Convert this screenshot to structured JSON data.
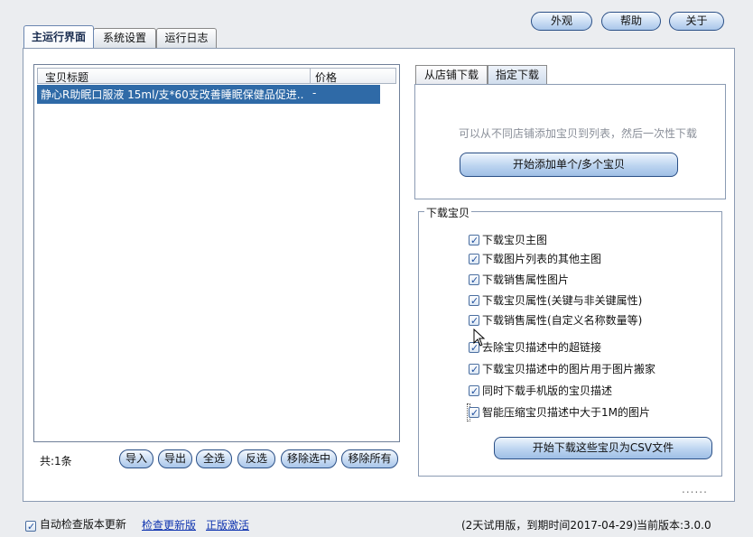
{
  "header_buttons": {
    "appearance": "外观",
    "help": "帮助",
    "about": "关于"
  },
  "tabs": {
    "main": "主运行界面",
    "settings": "系统设置",
    "log": "运行日志"
  },
  "list": {
    "col_title": "宝贝标题",
    "col_price": "价格",
    "rows": [
      {
        "title": "静心R助眠口服液 15ml/支*60支改善睡眠保健品促进...",
        "price": "-"
      }
    ]
  },
  "list_footer": {
    "count_text": "共:1条",
    "import": "导入",
    "export": "导出",
    "select_all": "全选",
    "invert": "反选",
    "remove_selected": "移除选中",
    "remove_all": "移除所有"
  },
  "sub_tabs": {
    "from_shop": "从店铺下载",
    "specified": "指定下载"
  },
  "sub_panel": {
    "hint": "可以从不同店铺添加宝贝到列表，然后一次性下载",
    "add_button": "开始添加单个/多个宝贝"
  },
  "download_group": {
    "title": "下载宝贝",
    "options": [
      {
        "label": "下载宝贝主图",
        "checked": true
      },
      {
        "label": "下载图片列表的其他主图",
        "checked": true
      },
      {
        "label": "下载销售属性图片",
        "checked": true
      },
      {
        "label": "下载宝贝属性(关键与非关键属性)",
        "checked": true
      },
      {
        "label": "下载销售属性(自定义名称数量等)",
        "checked": true
      },
      {
        "label": "去除宝贝描述中的超链接",
        "checked": true
      },
      {
        "label": "下载宝贝描述中的图片用于图片搬家",
        "checked": true
      },
      {
        "label": "同时下载手机版的宝贝描述",
        "checked": true
      },
      {
        "label": "智能压缩宝贝描述中大于1M的图片",
        "checked": true
      }
    ],
    "start_button": "开始下载这些宝贝为CSV文件"
  },
  "footer": {
    "auto_check_label": "自动检查版本更新",
    "check_update_link": "检查更新版",
    "activate_link": "正版激活",
    "trial_text": "(2天试用版，到期时间2017-04-29)",
    "version_text": "当前版本:3.0.0",
    "dots": "......"
  },
  "colors": {
    "accent": "#2f6aa7",
    "link": "#1035b0"
  }
}
